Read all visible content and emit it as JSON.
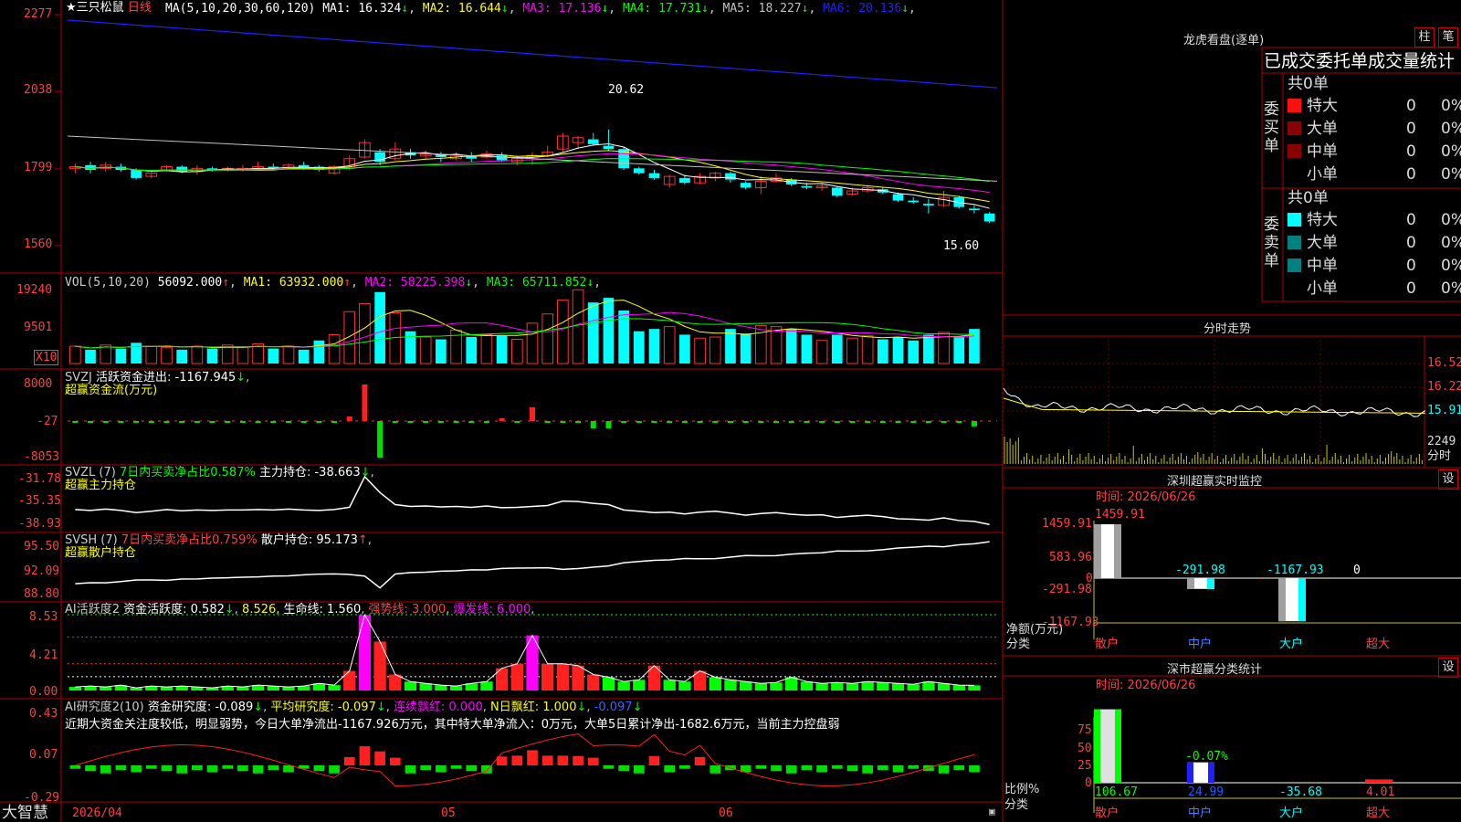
{
  "app": {
    "brand": "大智慧"
  },
  "stock": {
    "name": "三只松鼠",
    "period": "日线",
    "star": "★"
  },
  "indicators": {
    "ma_label": "MA(5,10,20,30,60,120)",
    "ma": [
      {
        "label": "MA1: 16.324",
        "arrow": "↓",
        "color": "#ffffff"
      },
      {
        "label": "MA2: 16.644",
        "arrow": "↓",
        "color": "#ffff00"
      },
      {
        "label": "MA3: 17.136",
        "arrow": "↓",
        "color": "#ff00ff"
      },
      {
        "label": "MA4: 17.731",
        "arrow": "↓",
        "color": "#00ff00"
      },
      {
        "label": "MA5: 18.227",
        "arrow": "↓",
        "color": "#c0c0c0"
      },
      {
        "label": "MA6: 20.136",
        "arrow": "↓",
        "color": "#2020ff"
      }
    ],
    "vol_label": "VOL(5,10,20)",
    "vol_value": "56092.000",
    "vol_ma": [
      {
        "label": "MA1: 63932.000",
        "arrow": "↑",
        "color": "#ffff00"
      },
      {
        "label": "MA2: 58225.398",
        "arrow": "↓",
        "color": "#ff00ff"
      },
      {
        "label": "MA3: 65711.852",
        "arrow": "↓",
        "color": "#00ff00"
      }
    ],
    "vol_unit": "X10",
    "svzj_name": "SVZJ",
    "svzj_text": "活跃资金进出: -1167.945",
    "svzj_sub": "超赢资金流(万元)",
    "svzl_name": "SVZL (7)",
    "svzl_ratio": "7日内买卖净占比0.587%",
    "svzl_text": "主力持仓: -38.663",
    "svzl_sub": "超赢主力持仓",
    "svsh_name": "SVSH (7)",
    "svsh_ratio": "7日内买卖净占比0.759%",
    "svsh_text": "散户持仓: 95.173",
    "svsh_sub": "超赢散户持仓",
    "ai1_name": "AI活跃度2",
    "ai1_text": "资金活跃度: 0.582",
    "ai1_val2": "8.526",
    "ai1_life": "生命线: 1.560",
    "ai1_strong": "强势线: 3.000",
    "ai1_burst": "爆发线: 6.000",
    "ai2_name": "AI研究度2(10)",
    "ai2_text": "资金研究度: -0.089",
    "ai2_avg": "平均研究度: -0.097",
    "ai2_red": "连续飘红: 0.000",
    "ai2_n": "N日飘红: 1.000",
    "ai2_last": "-0.097",
    "ai2_desc": "近期大资金关注度较低，明显弱势，今日大单净流出-1167.926万元，其中特大单净流入：0万元，大单5日累计净出-1682.6万元，当前主力控盘弱"
  },
  "axes": {
    "price": [
      "2277",
      "2038",
      "1799",
      "1560"
    ],
    "vol": [
      "19240",
      "9501"
    ],
    "svzj": [
      "8000",
      "-27",
      "-8053"
    ],
    "svzl": [
      "-31.78",
      "-35.35",
      "-38.93"
    ],
    "svsh": [
      "95.50",
      "92.09",
      "88.80"
    ],
    "ai1": [
      "8.53",
      "4.21",
      "0.00"
    ],
    "ai2": [
      "0.43",
      "0.07",
      "-0.29"
    ],
    "dates": [
      "2026/04",
      "05",
      "06"
    ]
  },
  "chart_data": {
    "type": "candlestick",
    "high_label": "20.62",
    "low_label": "15.60",
    "candles": [
      {
        "o": 18.0,
        "c": 18.05,
        "h": 18.15,
        "l": 17.85
      },
      {
        "o": 18.1,
        "c": 17.95,
        "h": 18.2,
        "l": 17.85
      },
      {
        "o": 18.0,
        "c": 18.1,
        "h": 18.2,
        "l": 17.9
      },
      {
        "o": 18.05,
        "c": 17.95,
        "h": 18.15,
        "l": 17.9
      },
      {
        "o": 17.95,
        "c": 17.7,
        "h": 18.0,
        "l": 17.65
      },
      {
        "o": 17.75,
        "c": 17.85,
        "h": 17.95,
        "l": 17.7
      },
      {
        "o": 17.95,
        "c": 18.05,
        "h": 18.1,
        "l": 17.9
      },
      {
        "o": 18.05,
        "c": 17.9,
        "h": 18.1,
        "l": 17.85
      },
      {
        "o": 17.9,
        "c": 18.0,
        "h": 18.1,
        "l": 17.8
      },
      {
        "o": 18.0,
        "c": 17.95,
        "h": 18.05,
        "l": 17.9
      },
      {
        "o": 17.95,
        "c": 18.0,
        "h": 18.05,
        "l": 17.9
      },
      {
        "o": 17.95,
        "c": 18.0,
        "h": 18.1,
        "l": 17.9
      },
      {
        "o": 18.0,
        "c": 18.05,
        "h": 18.2,
        "l": 17.95
      },
      {
        "o": 18.05,
        "c": 18.0,
        "h": 18.15,
        "l": 17.95
      },
      {
        "o": 18.0,
        "c": 18.1,
        "h": 18.15,
        "l": 17.95
      },
      {
        "o": 18.1,
        "c": 18.0,
        "h": 18.2,
        "l": 17.95
      },
      {
        "o": 18.05,
        "c": 17.95,
        "h": 18.1,
        "l": 17.9
      },
      {
        "o": 17.85,
        "c": 18.05,
        "h": 18.1,
        "l": 17.8
      },
      {
        "o": 18.0,
        "c": 18.3,
        "h": 18.4,
        "l": 17.95
      },
      {
        "o": 18.35,
        "c": 18.8,
        "h": 18.9,
        "l": 18.3
      },
      {
        "o": 18.5,
        "c": 18.2,
        "h": 18.6,
        "l": 18.1
      },
      {
        "o": 18.3,
        "c": 18.6,
        "h": 18.8,
        "l": 18.25
      },
      {
        "o": 18.5,
        "c": 18.4,
        "h": 18.6,
        "l": 18.3
      },
      {
        "o": 18.4,
        "c": 18.45,
        "h": 18.55,
        "l": 18.3
      },
      {
        "o": 18.4,
        "c": 18.35,
        "h": 18.5,
        "l": 18.2
      },
      {
        "o": 18.3,
        "c": 18.4,
        "h": 18.5,
        "l": 18.25
      },
      {
        "o": 18.4,
        "c": 18.3,
        "h": 18.5,
        "l": 18.2
      },
      {
        "o": 18.35,
        "c": 18.45,
        "h": 18.55,
        "l": 18.3
      },
      {
        "o": 18.4,
        "c": 18.25,
        "h": 18.5,
        "l": 18.2
      },
      {
        "o": 18.2,
        "c": 18.3,
        "h": 18.4,
        "l": 18.1
      },
      {
        "o": 18.35,
        "c": 18.4,
        "h": 18.5,
        "l": 18.1
      },
      {
        "o": 18.4,
        "c": 18.5,
        "h": 18.7,
        "l": 18.35
      },
      {
        "o": 18.6,
        "c": 19.0,
        "h": 19.1,
        "l": 18.5
      },
      {
        "o": 18.8,
        "c": 18.95,
        "h": 19.0,
        "l": 18.6
      },
      {
        "o": 18.9,
        "c": 18.75,
        "h": 19.1,
        "l": 18.7
      },
      {
        "o": 18.7,
        "c": 18.6,
        "h": 19.2,
        "l": 18.55
      },
      {
        "o": 18.6,
        "c": 18.0,
        "h": 18.65,
        "l": 17.95
      },
      {
        "o": 18.0,
        "c": 17.85,
        "h": 18.05,
        "l": 17.8
      },
      {
        "o": 17.85,
        "c": 17.7,
        "h": 17.95,
        "l": 17.65
      },
      {
        "o": 17.5,
        "c": 17.75,
        "h": 17.8,
        "l": 17.4
      },
      {
        "o": 17.7,
        "c": 17.55,
        "h": 17.8,
        "l": 17.5
      },
      {
        "o": 17.55,
        "c": 17.75,
        "h": 17.85,
        "l": 17.5
      },
      {
        "o": 17.7,
        "c": 17.85,
        "h": 17.9,
        "l": 17.6
      },
      {
        "o": 17.85,
        "c": 17.65,
        "h": 17.9,
        "l": 17.55
      },
      {
        "o": 17.55,
        "c": 17.4,
        "h": 17.6,
        "l": 17.35
      },
      {
        "o": 17.4,
        "c": 17.6,
        "h": 17.75,
        "l": 17.2
      },
      {
        "o": 17.6,
        "c": 17.7,
        "h": 17.85,
        "l": 17.55
      },
      {
        "o": 17.65,
        "c": 17.5,
        "h": 17.7,
        "l": 17.45
      },
      {
        "o": 17.45,
        "c": 17.4,
        "h": 17.55,
        "l": 17.35
      },
      {
        "o": 17.4,
        "c": 17.45,
        "h": 17.55,
        "l": 17.3
      },
      {
        "o": 17.4,
        "c": 17.15,
        "h": 17.45,
        "l": 17.1
      },
      {
        "o": 17.2,
        "c": 17.3,
        "h": 17.4,
        "l": 17.15
      },
      {
        "o": 17.3,
        "c": 17.4,
        "h": 17.45,
        "l": 17.25
      },
      {
        "o": 17.35,
        "c": 17.25,
        "h": 17.4,
        "l": 17.2
      },
      {
        "o": 17.2,
        "c": 17.0,
        "h": 17.25,
        "l": 16.95
      },
      {
        "o": 17.0,
        "c": 16.95,
        "h": 17.1,
        "l": 16.9
      },
      {
        "o": 16.9,
        "c": 16.85,
        "h": 17.05,
        "l": 16.6
      },
      {
        "o": 16.85,
        "c": 17.1,
        "h": 17.3,
        "l": 16.8
      },
      {
        "o": 17.1,
        "c": 16.8,
        "h": 17.15,
        "l": 16.75
      },
      {
        "o": 16.75,
        "c": 16.7,
        "h": 16.85,
        "l": 16.6
      },
      {
        "o": 16.6,
        "c": 16.35,
        "h": 16.65,
        "l": 16.3
      }
    ],
    "volume": [
      1.5,
      1.2,
      1.6,
      1.3,
      1.8,
      1.5,
      1.4,
      1.2,
      1.5,
      1.3,
      1.6,
      1.4,
      1.7,
      1.3,
      1.5,
      1.2,
      2.0,
      2.5,
      4.5,
      5.2,
      6.2,
      4.4,
      2.8,
      2.3,
      2.1,
      2.9,
      2.3,
      2.5,
      2.4,
      2.1,
      3.5,
      4.3,
      5.5,
      6.4,
      5.3,
      5.7,
      4.6,
      2.8,
      3.0,
      3.2,
      2.5,
      2.2,
      2.3,
      3.0,
      2.6,
      3.3,
      3.2,
      3.0,
      2.5,
      2.0,
      2.5,
      2.2,
      2.4,
      2.1,
      2.3,
      2.0,
      2.5,
      2.7,
      2.3,
      3.0
    ],
    "svzj": [
      -200,
      -180,
      -150,
      -220,
      -190,
      -160,
      -200,
      -180,
      -150,
      -170,
      -200,
      -150,
      -160,
      -180,
      -170,
      -150,
      -180,
      -160,
      1000,
      8000,
      -8000,
      -200,
      -180,
      -160,
      -190,
      -170,
      -200,
      -150,
      600,
      -200,
      3000,
      -180,
      -160,
      -190,
      -1600,
      -1600,
      -200,
      -180,
      -170,
      -160,
      -150,
      -180,
      -200,
      -170,
      -150,
      -180,
      -160,
      -200,
      -180,
      -170,
      -160,
      -150,
      -180,
      -200,
      -170,
      -160,
      -150,
      -180,
      -200,
      -1167.9
    ],
    "ai1": [
      0.4,
      0.5,
      0.4,
      0.6,
      0.3,
      0.5,
      0.4,
      0.5,
      0.4,
      0.3,
      0.5,
      0.4,
      0.6,
      0.5,
      0.4,
      0.5,
      0.8,
      0.6,
      2.2,
      8.5,
      5.5,
      1.8,
      1.0,
      0.8,
      0.6,
      0.5,
      0.8,
      1.0,
      2.5,
      3.0,
      6.2,
      3.0,
      3.0,
      2.8,
      1.8,
      1.5,
      1.0,
      1.2,
      2.8,
      1.2,
      1.0,
      2.2,
      1.5,
      1.2,
      1.0,
      0.8,
      0.9,
      1.5,
      1.0,
      0.8,
      0.9,
      0.8,
      1.0,
      0.9,
      0.8,
      0.7,
      1.0,
      0.8,
      0.6,
      0.58
    ]
  },
  "right": {
    "dragon_title": "龙虎看盘(逐单)",
    "btn_zhu": "柱",
    "btn_bi": "笔",
    "ob_title": "已成交委托单成交量统计",
    "buy_label": "委买单",
    "sell_label": "委卖单",
    "buy_total": "共0单",
    "sell_total": "共0单",
    "rows": [
      {
        "name": "特大",
        "count": "0",
        "pct": "0%"
      },
      {
        "name": "大单",
        "count": "0",
        "pct": "0%"
      },
      {
        "name": "中单",
        "count": "0",
        "pct": "0%"
      },
      {
        "name": "小单",
        "count": "0",
        "pct": "0%"
      }
    ],
    "timeshare_title": "分时走势",
    "timeshare_axis": [
      "16.52",
      "16.22",
      "15.91",
      "2249",
      "分时"
    ],
    "sz_title": "深圳超赢实时监控",
    "sz_time": "时间: 2026/06/26",
    "sz_btn": "设",
    "sz_axis": [
      "1459.91",
      "583.96",
      "0",
      "-291.98",
      "-1167.93"
    ],
    "sz_unit": "净额(万元)",
    "sz_class": "分类",
    "sz_bars": [
      {
        "cat": "散户",
        "value": 1459.91,
        "label": "1459.91"
      },
      {
        "cat": "中户",
        "value": -291.98,
        "label": "-291.98"
      },
      {
        "cat": "大户",
        "value": -1167.93,
        "label": "-1167.93"
      },
      {
        "cat": "超大",
        "value": 0,
        "label": "0"
      }
    ],
    "cls_title": "深市超赢分类统计",
    "cls_time": "时间: 2026/06/26",
    "cls_btn": "设",
    "cls_axis": [
      "75",
      "50",
      "25",
      "0"
    ],
    "cls_unit": "比例%",
    "cls_class": "分类",
    "cls_bar_label": "-0.07%",
    "cls_bars": [
      {
        "cat": "散户",
        "value": 106.67,
        "label": "106.67"
      },
      {
        "cat": "中户",
        "value": 24.99,
        "label": "24.99"
      },
      {
        "cat": "大户",
        "value": -35.68,
        "label": "-35.68"
      },
      {
        "cat": "超大",
        "value": 4.01,
        "label": "4.01"
      }
    ]
  }
}
